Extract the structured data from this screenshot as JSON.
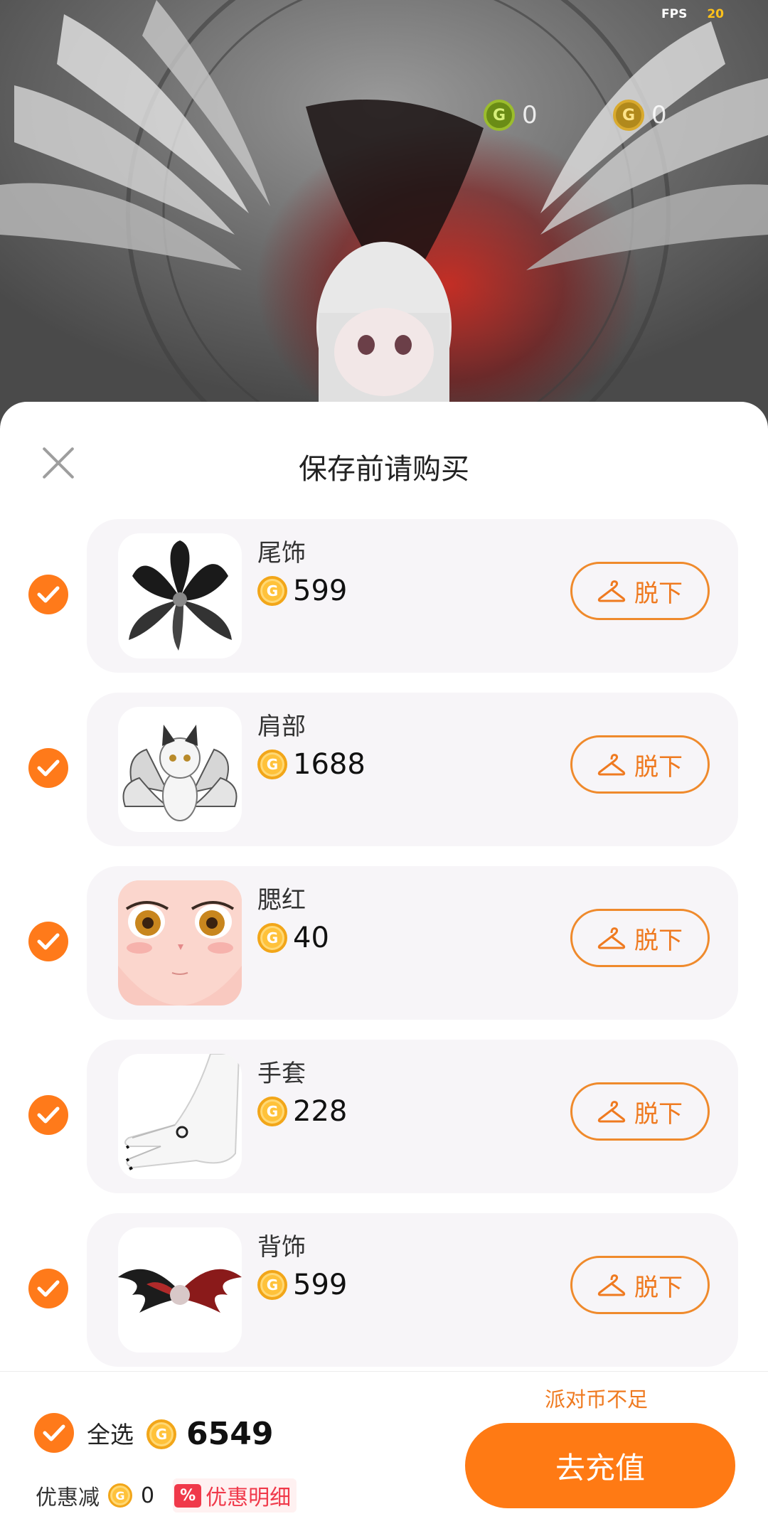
{
  "scene": {
    "fps_label": "FPS",
    "fps_value": "20",
    "green_currency_value": "0",
    "gold_currency_value": "0"
  },
  "dialog": {
    "title": "保存前请购买",
    "items": [
      {
        "name": "尾饰",
        "price": "599",
        "action": "脱下",
        "thumb_icon": "tail-ornament-icon"
      },
      {
        "name": "肩部",
        "price": "1688",
        "action": "脱下",
        "thumb_icon": "shoulder-fox-icon"
      },
      {
        "name": "腮红",
        "price": "40",
        "action": "脱下",
        "thumb_icon": "blush-face-icon"
      },
      {
        "name": "手套",
        "price": "228",
        "action": "脱下",
        "thumb_icon": "glove-hand-icon"
      },
      {
        "name": "背饰",
        "price": "599",
        "action": "脱下",
        "thumb_icon": "back-wings-icon"
      }
    ]
  },
  "footer": {
    "select_all_label": "全选",
    "total_price": "6549",
    "discount_label": "优惠减",
    "discount_value": "0",
    "discount_badge": "%",
    "discount_detail_label": "优惠明细",
    "insufficient_text": "派对币不足",
    "recharge_label": "去充值"
  },
  "colors": {
    "accent_orange": "#ff7a14",
    "coin_gold": "#ffc23a",
    "discount_red": "#f0394a"
  }
}
